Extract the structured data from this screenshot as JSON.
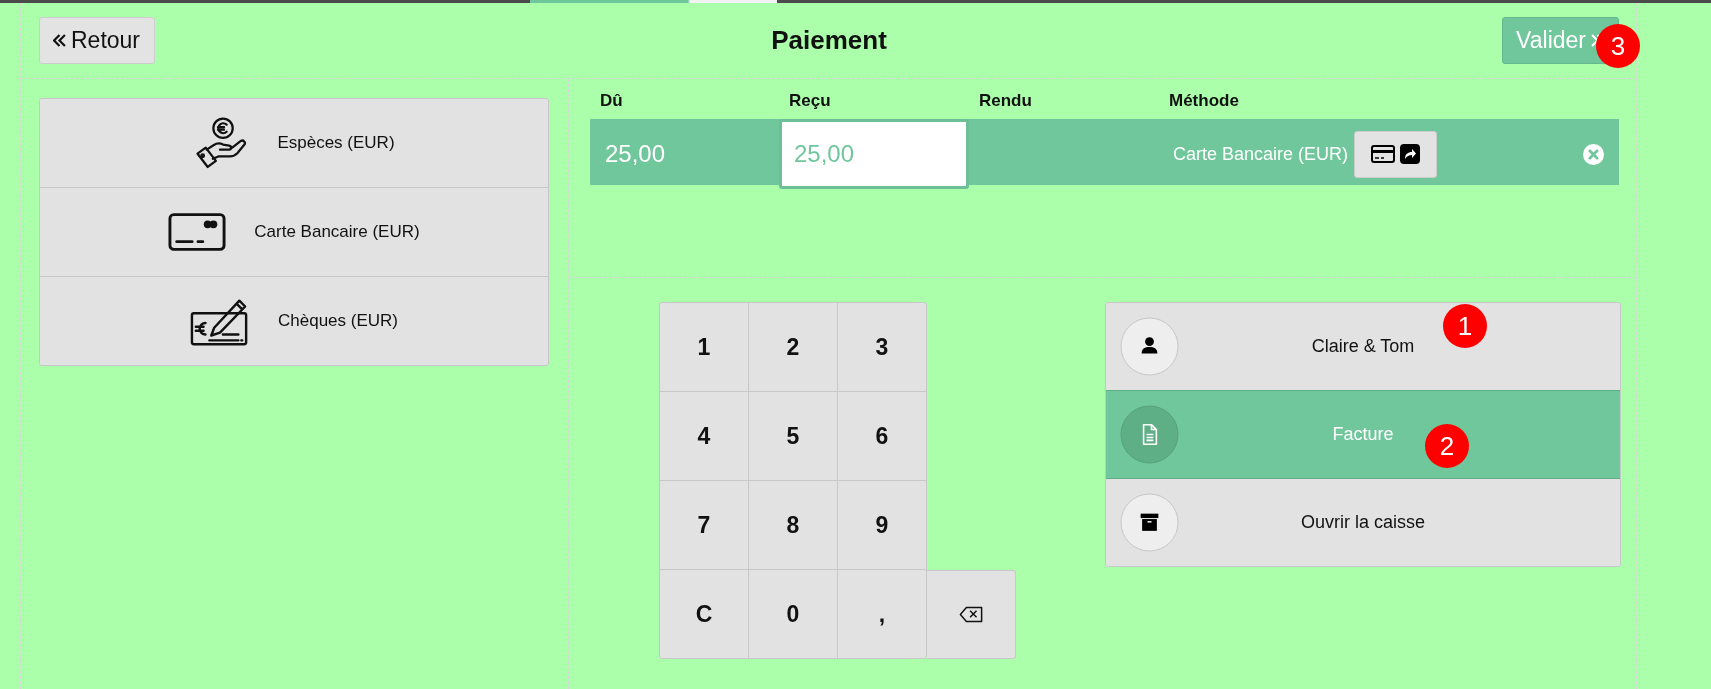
{
  "header": {
    "back_button": {
      "label": "Retour"
    },
    "title": "Paiement",
    "validate_button": {
      "label": "Valider",
      "primary": true
    }
  },
  "payment_methods": [
    {
      "kind": "cash",
      "label": "Espèces (EUR)"
    },
    {
      "kind": "card",
      "label": "Carte Bancaire (EUR)"
    },
    {
      "kind": "cheque",
      "label": "Chèques (EUR)"
    }
  ],
  "payment_lines": {
    "columns": [
      "Dû",
      "Reçu",
      "Rendu",
      "Méthode"
    ],
    "rows": [
      {
        "due": "25,00",
        "received": "25,00",
        "method": "Carte Bancaire (EUR)",
        "selected": true,
        "focused": true
      }
    ]
  },
  "numpad": {
    "keys": [
      {
        "kind": "key",
        "label": "1"
      },
      {
        "kind": "key",
        "label": "2"
      },
      {
        "kind": "key",
        "label": "3"
      },
      {
        "kind": "key",
        "label": "4"
      },
      {
        "kind": "key",
        "label": "5"
      },
      {
        "kind": "key",
        "label": "6"
      },
      {
        "kind": "key",
        "label": "7"
      },
      {
        "kind": "key",
        "label": "8"
      },
      {
        "kind": "key",
        "label": "9"
      },
      {
        "kind": "key",
        "label": "C"
      },
      {
        "kind": "key",
        "label": "0"
      },
      {
        "kind": "key",
        "label": ","
      },
      {
        "kind": "backspace"
      }
    ]
  },
  "actions": [
    {
      "kind": "customer",
      "label": "Claire & Tom",
      "selected": false
    },
    {
      "kind": "invoice",
      "label": "Facture",
      "selected": true
    },
    {
      "kind": "cash_drawer",
      "label": "Ouvrir la caisse",
      "selected": false
    }
  ],
  "annotations": [
    {
      "label": "1"
    },
    {
      "label": "2"
    },
    {
      "label": "3"
    }
  ]
}
